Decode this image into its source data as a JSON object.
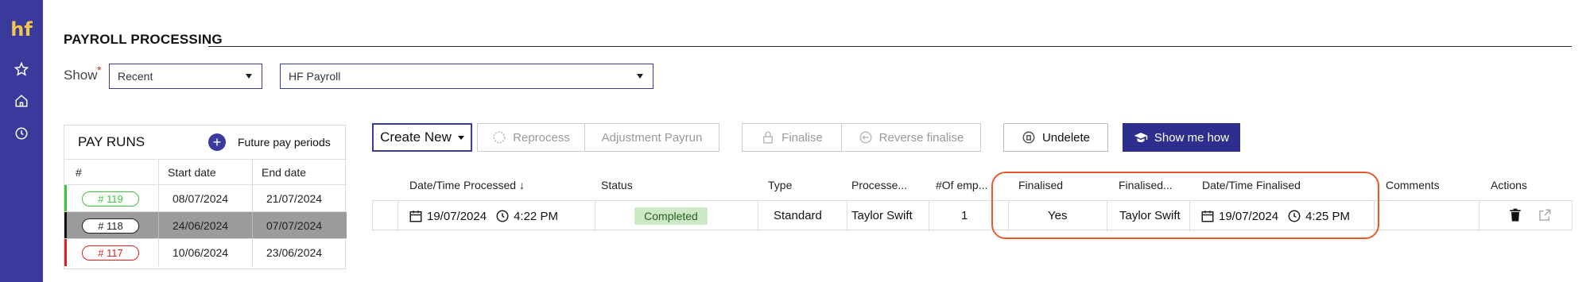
{
  "nav": {
    "logo_text": "hf",
    "icons": [
      "star-icon",
      "home-icon",
      "clock-icon"
    ]
  },
  "page": {
    "title": "PAYROLL PROCESSING"
  },
  "filters": {
    "show_label": "Show",
    "required_mark": "*",
    "range_value": "Recent",
    "payroll_value": "HF Payroll"
  },
  "pay_runs": {
    "title": "PAY RUNS",
    "future_label": "Future pay periods",
    "columns": [
      "#",
      "Start date",
      "End date"
    ],
    "rows": [
      {
        "id": "# 119",
        "start": "08/07/2024",
        "end": "21/07/2024",
        "color": "#3cc43c",
        "selected": false
      },
      {
        "id": "# 118",
        "start": "24/06/2024",
        "end": "07/07/2024",
        "color": "#222222",
        "selected": true
      },
      {
        "id": "# 117",
        "start": "10/06/2024",
        "end": "23/06/2024",
        "color": "#e02020",
        "selected": false
      }
    ]
  },
  "toolbar": {
    "create_new": "Create New",
    "reprocess": "Reprocess",
    "adjustment": "Adjustment Payrun",
    "finalise": "Finalise",
    "reverse_finalise": "Reverse finalise",
    "undelete": "Undelete",
    "show_me_how": "Show me how"
  },
  "table": {
    "headers": {
      "processed": "Date/Time Processed",
      "status": "Status",
      "type": "Type",
      "processed_by": "Processe...",
      "employees": "#Of emp...",
      "finalised": "Finalised",
      "finalised_by": "Finalised...",
      "finalised_at": "Date/Time Finalised",
      "comments": "Comments",
      "actions": "Actions"
    },
    "row": {
      "processed_date": "19/07/2024",
      "processed_time": "4:22 PM",
      "status": "Completed",
      "type": "Standard",
      "processed_by": "Taylor Swift",
      "employees": "1",
      "finalised": "Yes",
      "finalised_by": "Taylor Swift",
      "finalised_date": "19/07/2024",
      "finalised_time": "4:25 PM"
    }
  },
  "colors": {
    "nav": "#3a3a9c",
    "accent": "#2e2e8f",
    "logo": "#f3c54a",
    "highlight": "#e8592a",
    "status_bg": "#cde8c5"
  }
}
